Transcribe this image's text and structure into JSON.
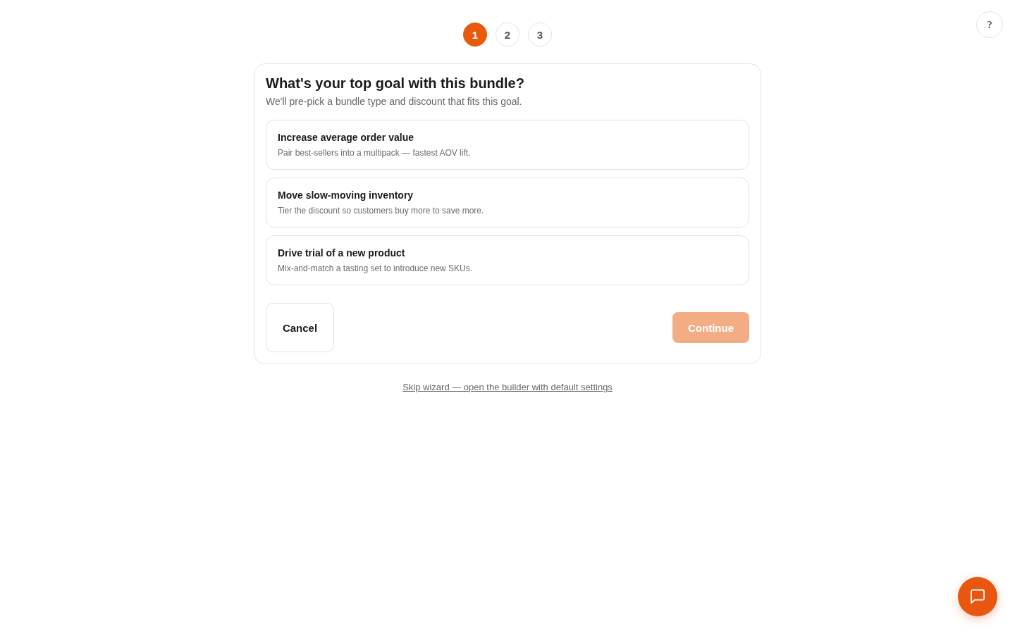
{
  "help_button": {
    "label": "?"
  },
  "stepper": [
    {
      "label": "1",
      "selected": true
    },
    {
      "label": "2",
      "selected": false
    },
    {
      "label": "3",
      "selected": false
    }
  ],
  "card": {
    "title": "What's your top goal with this bundle?",
    "subtitle": "We'll pre-pick a bundle type and discount that fits this goal.",
    "options": [
      {
        "title": "Increase average order value",
        "description": "Pair best-sellers into a multipack — fastest AOV lift.",
        "selected": false
      },
      {
        "title": "Move slow-moving inventory",
        "description": "Tier the discount so customers buy more to save more.",
        "selected": false
      },
      {
        "title": "Drive trial of a new product",
        "description": "Mix-and-match a tasting set to introduce new SKUs.",
        "selected": false
      }
    ],
    "buttons": [
      {
        "kind": "secondary",
        "label": "Cancel",
        "disabled": false
      },
      {
        "kind": "primary",
        "label": "Continue",
        "disabled": true
      }
    ]
  },
  "skip_link": "Skip wizard — open the builder with default settings"
}
